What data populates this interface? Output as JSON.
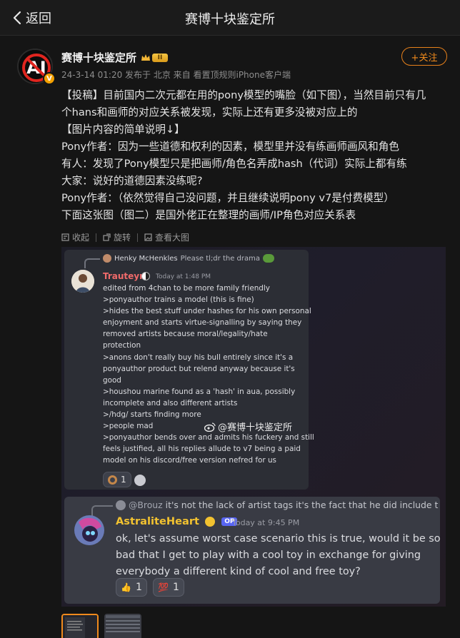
{
  "header": {
    "back_label": "返回",
    "title": "赛博十块鉴定所"
  },
  "post": {
    "author": "赛博十块鉴定所",
    "rank_badge": "II",
    "verified_badge": "V",
    "meta": "24-3-14 01:20 发布于 北京  来自 看置顶规则iPhone客户端",
    "follow_label": "+关注",
    "content_lines": [
      "【投稿】目前国内二次元都在用的pony模型的嘴脸（如下图），当然目前只有几",
      "个hans和画师的对应关系被发现，实际上还有更多没被对应上的",
      "【图片内容的简单说明↓】",
      "Pony作者：因为一些道德和权利的因素，模型里并没有练画师画风和角色",
      "有人：发现了Pony模型只是把画师/角色名弄成hash（代词）实际上都有练",
      "大家：说好的道德因素没练呢?",
      "Pony作者：（依然觉得自己没问题，并且继续说明pony v7是付费模型）",
      "下面这张图（图二）是国外佬正在整理的画师/IP角色对应关系表"
    ],
    "tools": {
      "collect": "收起",
      "rotate": "旋转",
      "view_large": "查看大图"
    }
  },
  "image": {
    "msg1": {
      "reply_name": "Henky McHenkles",
      "reply_text": "Please tl;dr the drama",
      "author": "Trauteyr",
      "time": "Today at 1:48 PM",
      "lines": [
        "edited from 4chan to be more family friendly",
        ">ponyauthor trains a model (this is fine)",
        ">hides the best stuff under hashes for his own personal",
        "enjoyment and starts virtue-signalling by saying they",
        "removed artists because moral/legality/hate",
        "protection",
        ">anons don't really buy his bull entirely since it's a",
        "ponyauthor product but relend anyway because it's",
        "good",
        ">houshou marine found as a 'hash' in aua, possibly",
        "incomplete and also different artists",
        ">/hdg/ starts finding more",
        ">people mad",
        ">ponyauthor bends over and admits his fuckery and still",
        "feels justified, all his replies allude to v7 being a paid",
        "model on his discord/free version nefred for us"
      ],
      "reaction_count": "1"
    },
    "watermark": "@赛博十块鉴定所",
    "msg2": {
      "reply_name": "@Brouz",
      "reply_text": "it's not the lack of artist tags it's the fact that he did include t",
      "author": "AstraliteHeart",
      "op_label": "OP",
      "time": "Today at 9:45 PM",
      "lines": [
        "ok, let's assume worst case scenario this is true, would it be so",
        "bad that I get to play with a cool toy in exchange for giving",
        "everybody a different kind of cool and free toy?"
      ],
      "reactions": [
        {
          "emoji": "👍",
          "count": "1"
        },
        {
          "emoji": "💯",
          "count": "1"
        }
      ]
    }
  },
  "colors": {
    "accent": "#f08a1c",
    "trauteyr": "#f06a6a",
    "astralite": "#f2c230",
    "op": "#5865f2"
  }
}
